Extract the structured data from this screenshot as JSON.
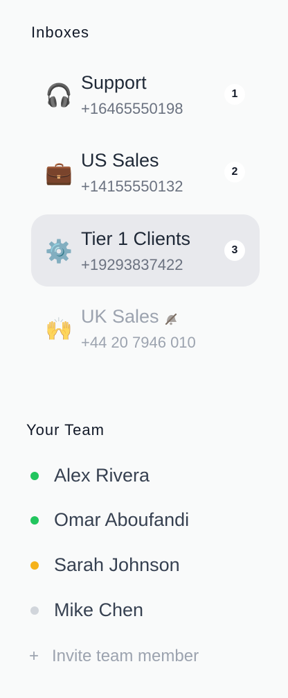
{
  "inboxes": {
    "title": "Inboxes",
    "items": [
      {
        "emoji": "🎧",
        "icon": "headphones-icon",
        "name": "Support",
        "phone": "+16465550198",
        "badge": "1",
        "active": false,
        "muted": false
      },
      {
        "emoji": "💼",
        "icon": "briefcase-icon",
        "name": "US Sales",
        "phone": "+14155550132",
        "badge": "2",
        "active": false,
        "muted": false
      },
      {
        "emoji": "⚙️",
        "icon": "gear-icon",
        "name": "Tier 1 Clients",
        "phone": "+19293837422",
        "badge": "3",
        "active": true,
        "muted": false
      },
      {
        "emoji": "🙌",
        "icon": "raised-hands-icon",
        "name": "UK Sales",
        "phone": "+44 20 7946 010",
        "badge": null,
        "active": false,
        "muted": true,
        "status_icon": "muted-bell-icon"
      }
    ]
  },
  "team": {
    "title": "Your Team",
    "members": [
      {
        "name": "Alex Rivera",
        "status_color": "#22c55e"
      },
      {
        "name": "Omar Aboufandi",
        "status_color": "#22c55e"
      },
      {
        "name": "Sarah Johnson",
        "status_color": "#f5b21b"
      },
      {
        "name": "Mike Chen",
        "status_color": "#d1d5db"
      }
    ],
    "invite_label": "Invite team member",
    "invite_icon": "+"
  },
  "colors": {
    "active_bg": "#e8e9ed",
    "background": "#f9fafa"
  }
}
